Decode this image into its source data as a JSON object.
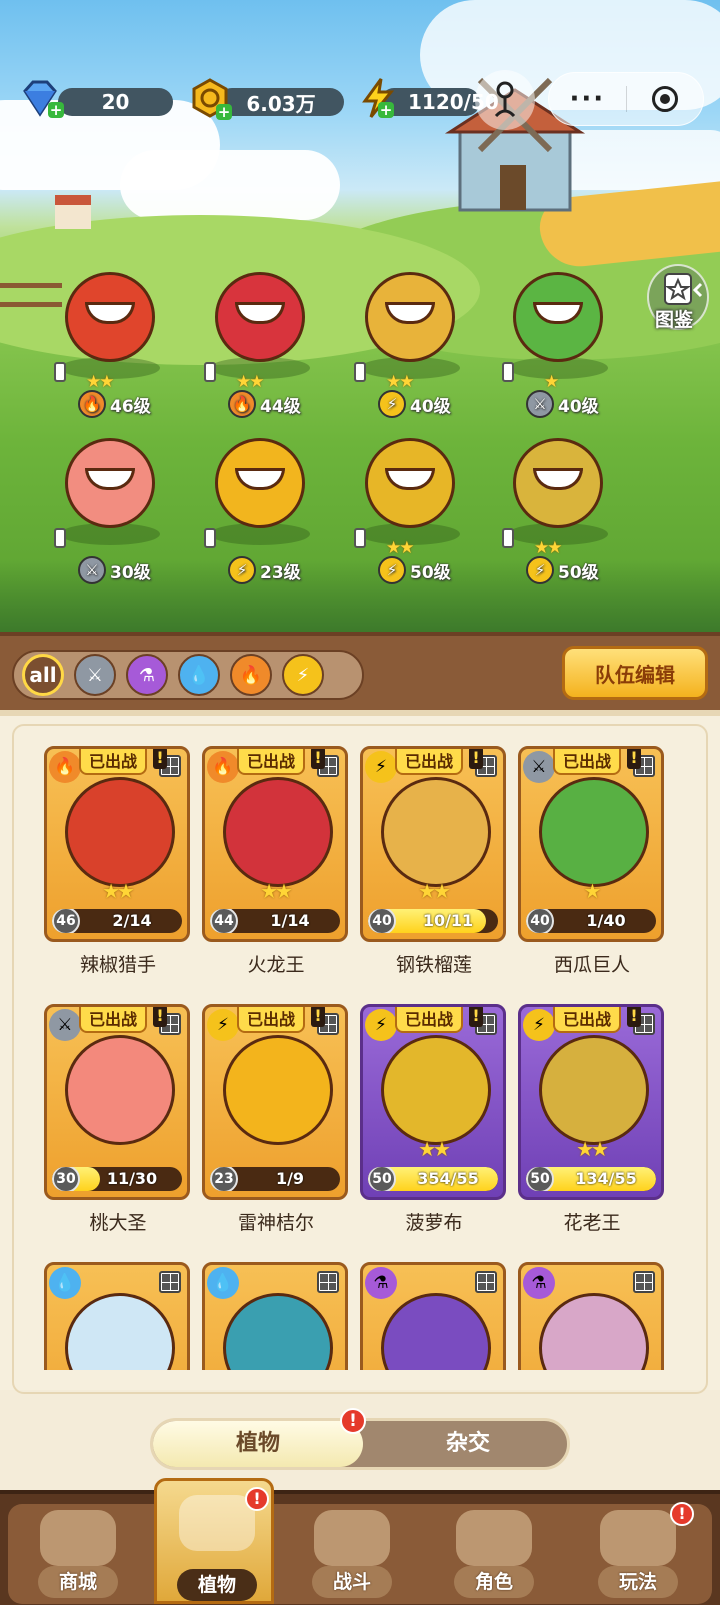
{
  "resources": {
    "gems": "20",
    "gold": "6.03万",
    "energy": "1120/50"
  },
  "top_buttons": {
    "more": "···"
  },
  "codex_label": "图鉴",
  "field_heroes": [
    {
      "level": "46级",
      "element": "fire",
      "stars": "★★",
      "color": "#e0452c"
    },
    {
      "level": "44级",
      "element": "fire",
      "stars": "★★",
      "color": "#d8343d"
    },
    {
      "level": "40级",
      "element": "bolt",
      "stars": "★★",
      "color": "#e8b33a"
    },
    {
      "level": "40级",
      "element": "stone",
      "stars": "★",
      "color": "#5bb543"
    },
    {
      "level": "30级",
      "element": "stone",
      "stars": "",
      "color": "#f28d80"
    },
    {
      "level": "23级",
      "element": "bolt",
      "stars": "",
      "color": "#f2b51e"
    },
    {
      "level": "50级",
      "element": "bolt",
      "stars": "★★",
      "color": "#e7b627"
    },
    {
      "level": "50级",
      "element": "bolt",
      "stars": "★★",
      "color": "#d9b43c"
    }
  ],
  "filters": {
    "all_label": "all",
    "items": [
      "all",
      "stone",
      "poison",
      "water",
      "fire",
      "bolt"
    ],
    "team_edit": "队伍编辑"
  },
  "cards": [
    {
      "name": "辣椒猎手",
      "deployed": "已出战",
      "level": "46",
      "progress": "2/14",
      "fill": 0.14,
      "element": "fire",
      "stars": "★★",
      "rarity": "gold",
      "art": "#d9412b"
    },
    {
      "name": "火龙王",
      "deployed": "已出战",
      "level": "44",
      "progress": "1/14",
      "fill": 0.07,
      "element": "fire",
      "stars": "★★",
      "rarity": "gold",
      "art": "#d2333b"
    },
    {
      "name": "钢铁榴莲",
      "deployed": "已出战",
      "level": "40",
      "progress": "10/11",
      "fill": 0.91,
      "element": "bolt",
      "stars": "★★",
      "rarity": "gold",
      "art": "#e7b24a"
    },
    {
      "name": "西瓜巨人",
      "deployed": "已出战",
      "level": "40",
      "progress": "1/40",
      "fill": 0.03,
      "element": "stone",
      "stars": "★",
      "rarity": "gold",
      "art": "#58b043"
    },
    {
      "name": "桃大圣",
      "deployed": "已出战",
      "level": "30",
      "progress": "11/30",
      "fill": 0.37,
      "element": "stone",
      "stars": "",
      "rarity": "gold",
      "art": "#f3897c"
    },
    {
      "name": "雷神桔尔",
      "deployed": "已出战",
      "level": "23",
      "progress": "1/9",
      "fill": 0.11,
      "element": "bolt",
      "stars": "",
      "rarity": "gold",
      "art": "#f3b41c"
    },
    {
      "name": "菠萝布",
      "deployed": "已出战",
      "level": "50",
      "progress": "354/55",
      "fill": 1,
      "element": "bolt",
      "stars": "★★",
      "rarity": "purple",
      "art": "#e3b72b"
    },
    {
      "name": "花老王",
      "deployed": "已出战",
      "level": "50",
      "progress": "134/55",
      "fill": 1,
      "element": "bolt",
      "stars": "★★",
      "rarity": "purple",
      "art": "#d6b03e"
    },
    {
      "name": "",
      "deployed": "",
      "level": "",
      "progress": "",
      "fill": 0,
      "element": "water",
      "stars": "",
      "rarity": "gold",
      "art": "#cfe7f5"
    },
    {
      "name": "",
      "deployed": "",
      "level": "",
      "progress": "",
      "fill": 0,
      "element": "water",
      "stars": "",
      "rarity": "gold",
      "art": "#3a9fb0"
    },
    {
      "name": "",
      "deployed": "",
      "level": "",
      "progress": "",
      "fill": 0,
      "element": "poison",
      "stars": "",
      "rarity": "gold",
      "art": "#7a4cc0"
    },
    {
      "name": "",
      "deployed": "",
      "level": "",
      "progress": "",
      "fill": 0,
      "element": "poison",
      "stars": "",
      "rarity": "gold",
      "art": "#d8a7c8"
    }
  ],
  "toggle": {
    "plants": "植物",
    "hybrid": "杂交",
    "alert": "!"
  },
  "nav": [
    {
      "label": "商城",
      "alert": ""
    },
    {
      "label": "植物",
      "alert": "!"
    },
    {
      "label": "战斗",
      "alert": ""
    },
    {
      "label": "角色",
      "alert": ""
    },
    {
      "label": "玩法",
      "alert": "!"
    }
  ],
  "colors": {
    "fire": "#f08a2a",
    "bolt": "#f5c21b",
    "stone": "#8f98a3",
    "water": "#4eb2f0",
    "poison": "#a65ad8"
  }
}
